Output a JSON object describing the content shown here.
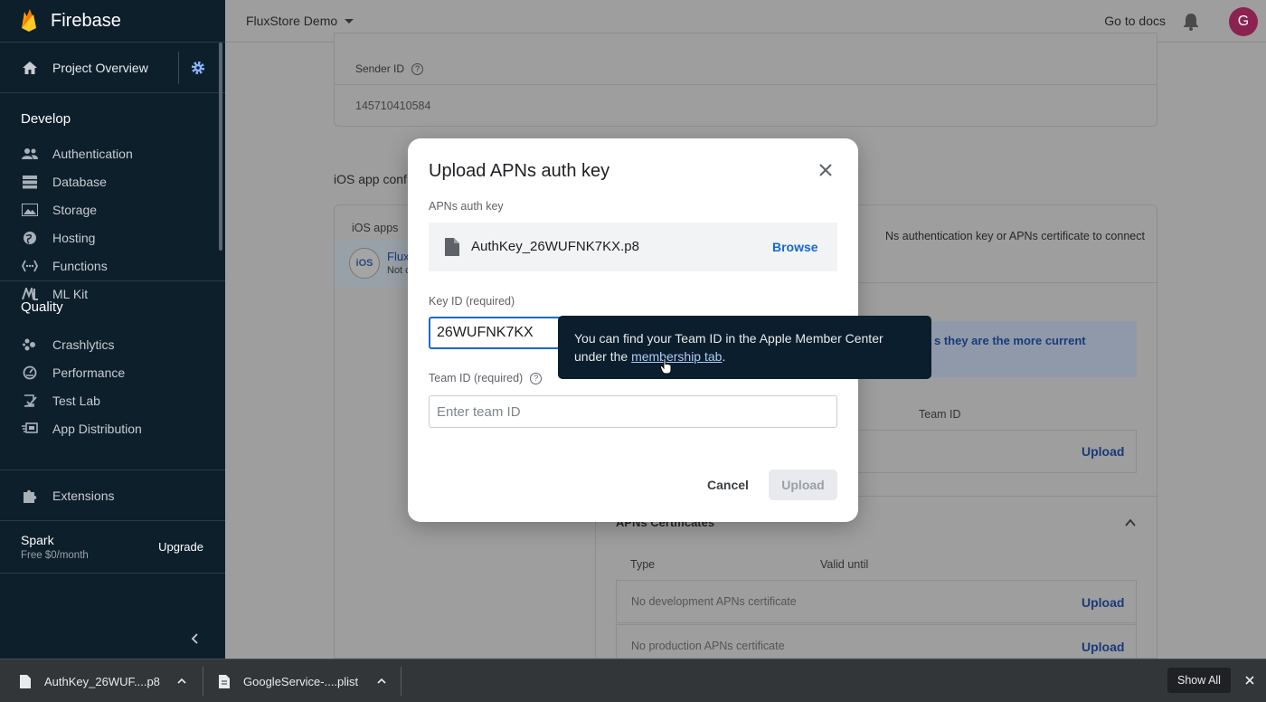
{
  "sidebar": {
    "brand": "Firebase",
    "overview": "Project Overview",
    "develop": {
      "title": "Develop",
      "items": [
        "Authentication",
        "Database",
        "Storage",
        "Hosting",
        "Functions",
        "ML Kit"
      ]
    },
    "quality": {
      "title": "Quality",
      "items": [
        "Crashlytics",
        "Performance",
        "Test Lab",
        "App Distribution"
      ]
    },
    "extensions": "Extensions",
    "plan": {
      "name": "Spark",
      "price": "Free $0/month",
      "upgrade": "Upgrade"
    }
  },
  "topbar": {
    "project": "FluxStore Demo",
    "docs": "Go to docs",
    "avatar_letter": "G"
  },
  "background": {
    "sender_id_label": "Sender ID",
    "sender_id_value": "145710410584",
    "ios_config_heading": "iOS app confi",
    "ios_apps_label": "iOS apps",
    "ios_badge": "iOS",
    "app_name": "Flux",
    "app_sub": "Not c",
    "apns_text": "Ns authentication key or APNs certificate to connect",
    "blue_box_text": "s they are the more current",
    "team_id_header": "Team ID",
    "upload": "Upload",
    "apns_certs_heading": "APNs Certificates",
    "type_header": "Type",
    "valid_header": "Valid until",
    "dev_cert": "No development APNs certificate",
    "prod_cert": "No production APNs certificate"
  },
  "modal": {
    "title": "Upload APNs auth key",
    "file_label": "APNs auth key",
    "file_name": "AuthKey_26WUFNK7KX.p8",
    "browse": "Browse",
    "key_label": "Key ID (required)",
    "key_value": "26WUFNK7KX",
    "team_label": "Team ID (required)",
    "team_placeholder": "Enter team ID",
    "cancel": "Cancel",
    "upload": "Upload"
  },
  "tooltip": {
    "text_before": "You can find your Team ID in the Apple Member Center under the ",
    "link": "membership tab",
    "text_after": "."
  },
  "downloads": {
    "items": [
      "AuthKey_26WUF....p8",
      "GoogleService-....plist"
    ],
    "show_all": "Show All"
  },
  "colors": {
    "sidebar_bg": "#0e1f2c",
    "accent_blue": "#1967d2",
    "avatar": "#8b2252",
    "tooltip_bg": "#0b1e2d"
  }
}
